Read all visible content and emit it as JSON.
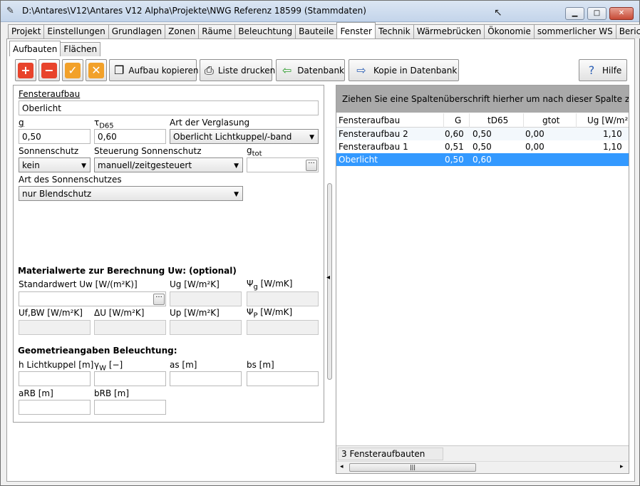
{
  "window": {
    "title": "D:\\Antares\\V12\\Antares V12 Alpha\\Projekte\\NWG Referenz 18599 (Stammdaten)",
    "minimize": "▁",
    "maximize": "□",
    "close": "✕"
  },
  "tabs": [
    "Projekt",
    "Einstellungen",
    "Grundlagen",
    "Zonen",
    "Räume",
    "Beleuchtung",
    "Bauteile",
    "Fenster",
    "Technik",
    "Wärmebrücken",
    "Ökonomie",
    "sommerlicher WS",
    "Bericht"
  ],
  "active_tab": "Fenster",
  "subtabs": [
    "Aufbauten",
    "Flächen"
  ],
  "toolbar": {
    "add_icon": "+",
    "remove_icon": "−",
    "confirm_icon": "✓",
    "cancel_icon": "✕",
    "copy_label": "Aufbau kopieren",
    "print_label": "Liste drucken",
    "db_label": "Datenbank",
    "copy_db_label": "Kopie in Datenbank",
    "help_label": "Hilfe",
    "colors": {
      "add": "#e8432b",
      "remove": "#e8432b",
      "confirm": "#f2a12a",
      "cancel": "#f2a12a"
    }
  },
  "form": {
    "fensteraufbau_label": "Fensteraufbau",
    "fensteraufbau_value": "Oberlicht",
    "g_label": "g",
    "g_value": "0,50",
    "tau_label_main": "τ",
    "tau_label_sub": "D65",
    "tau_value": "0,60",
    "verglasung_label": "Art der Verglasung",
    "verglasung_value": "Oberlicht Lichtkuppel/-band",
    "sonnenschutz_label": "Sonnenschutz",
    "sonnenschutz_value": "kein",
    "steuerung_label": "Steuerung Sonnenschutz",
    "steuerung_value": "manuell/zeitgesteuert",
    "gtot_label_main": "g",
    "gtot_label_sub": "tot",
    "gtot_value": "",
    "art_sonnenschutz_label": "Art des Sonnenschutzes",
    "art_sonnenschutz_value": "nur Blendschutz",
    "material_heading": "Materialwerte zur Berechnung Uw: (optional)",
    "uw_label": "Standardwert Uw [W/(m²K)]",
    "ug_label": "Ug [W/m²K]",
    "psig_main": "Ψ",
    "psig_sub": "g",
    "psig_unit": " [W/mK]",
    "ufbw_label": "Uf,BW [W/m²K]",
    "du_label": "ΔU [W/m²K]",
    "up_label": "Up [W/m²K]",
    "psip_main": "Ψ",
    "psip_sub": "P",
    "psip_unit": " [W/mK]",
    "geo_heading": "Geometrieangaben Beleuchtung:",
    "h_label": "h Lichtkuppel  [m]",
    "gamma_main": "γ",
    "gamma_sub": "W",
    "gamma_unit": "  [−]",
    "as_label": "as  [m]",
    "bs_label": "bs  [m]",
    "arb_label": "aRB  [m]",
    "brb_label": "bRB  [m]",
    "dots": "···"
  },
  "grid": {
    "group_hint": "Ziehen Sie eine Spaltenüberschrift hierher um nach dieser Spalte zu grup",
    "columns": [
      "Fensteraufbau",
      "G",
      "tD65",
      "gtot",
      "Ug [W/m²"
    ],
    "rows": [
      {
        "name": "Fensteraufbau 2",
        "g": "0,60",
        "t": "0,50",
        "gtot": "0,00",
        "ug": "1,10"
      },
      {
        "name": "Fensteraufbau 1",
        "g": "0,51",
        "t": "0,50",
        "gtot": "0,00",
        "ug": "1,10"
      },
      {
        "name": "Oberlicht",
        "g": "0,50",
        "t": "0,60",
        "gtot": "",
        "ug": ""
      }
    ],
    "selected_row": 2,
    "footer": "3 Fensteraufbauten",
    "scroll_left": "◂",
    "scroll_right": "▸",
    "scroll_grip": "|||"
  }
}
